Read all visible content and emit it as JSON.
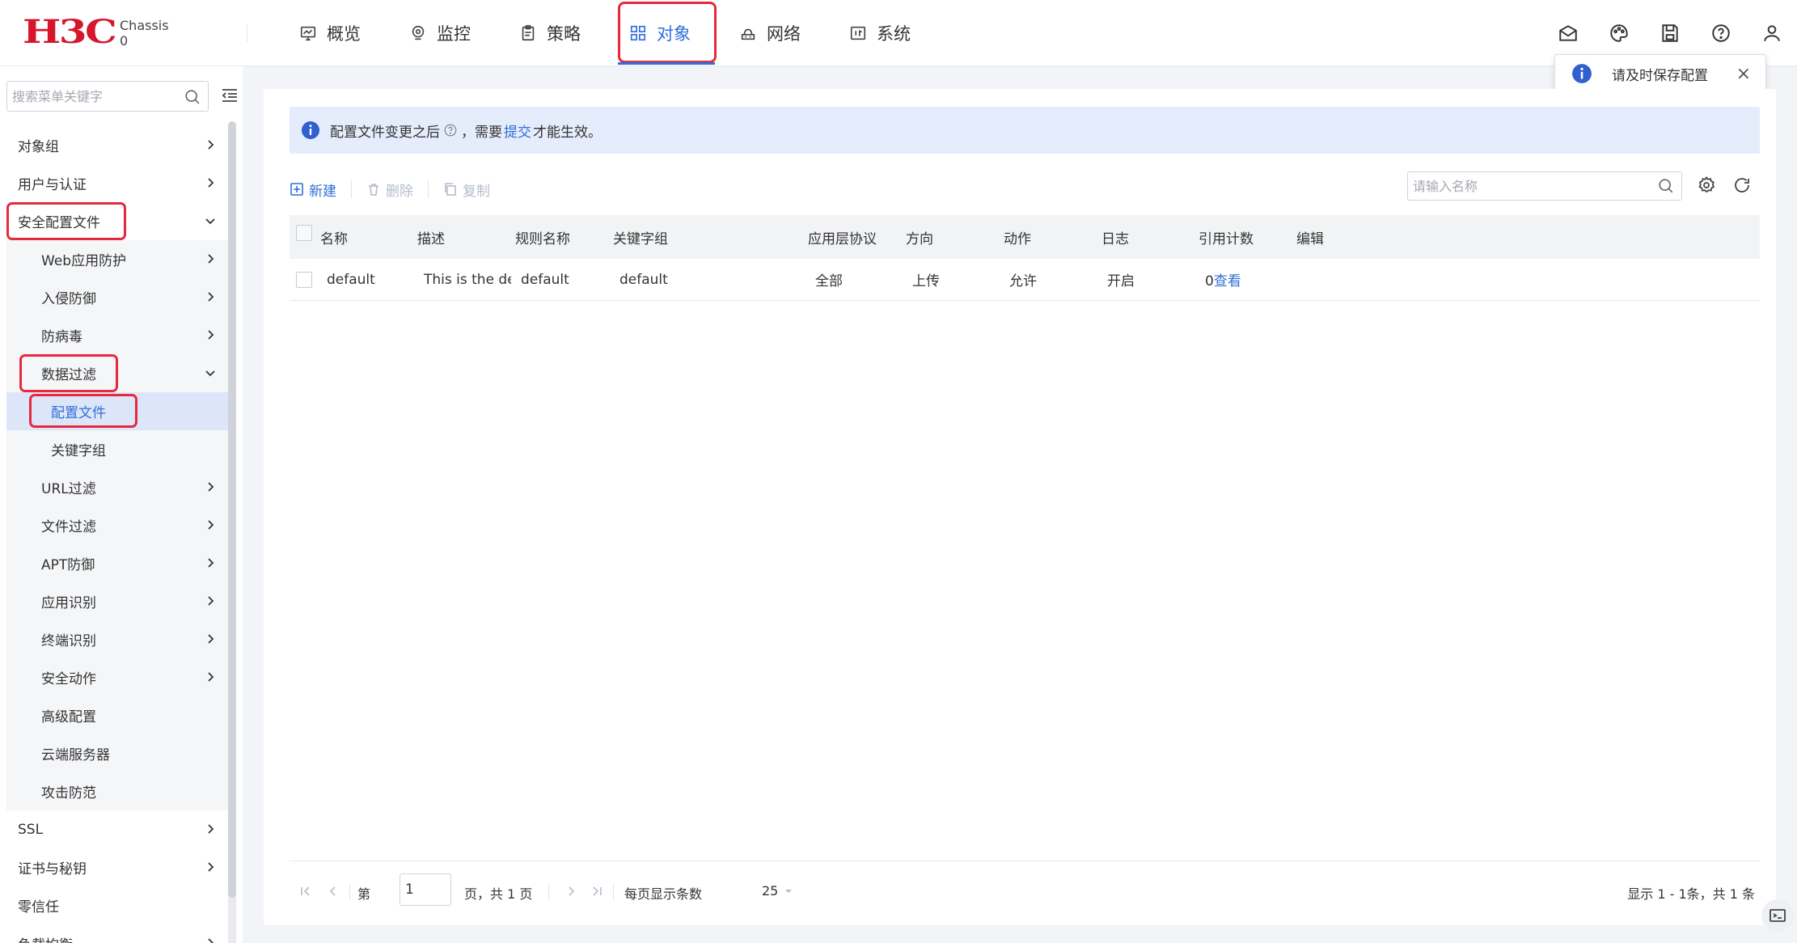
{
  "brand": {
    "logo_text": "H3C",
    "device_line1": "Chassis",
    "device_line2": "0"
  },
  "nav": {
    "items": [
      {
        "label": "概览",
        "icon": "monitor-chart-icon"
      },
      {
        "label": "监控",
        "icon": "location-pin-icon"
      },
      {
        "label": "策略",
        "icon": "clipboard-icon"
      },
      {
        "label": "对象",
        "icon": "grid-icon"
      },
      {
        "label": "网络",
        "icon": "network-icon"
      },
      {
        "label": "系统",
        "icon": "system-icon"
      }
    ],
    "active": "对象"
  },
  "top_icons": [
    "mail-icon",
    "palette-icon",
    "save-icon",
    "help-icon",
    "user-icon"
  ],
  "toast": {
    "text": "请及时保存配置",
    "close": "×"
  },
  "sidebar": {
    "search_placeholder": "搜索菜单关键字",
    "items": [
      {
        "label": "对象组"
      },
      {
        "label": "用户与认证"
      },
      {
        "label": "安全配置文件"
      },
      {
        "label": "Web应用防护"
      },
      {
        "label": "入侵防御"
      },
      {
        "label": "防病毒"
      },
      {
        "label": "数据过滤"
      },
      {
        "label": "配置文件"
      },
      {
        "label": "关键字组"
      },
      {
        "label": "URL过滤"
      },
      {
        "label": "文件过滤"
      },
      {
        "label": "APT防御"
      },
      {
        "label": "应用识别"
      },
      {
        "label": "终端识别"
      },
      {
        "label": "安全动作"
      },
      {
        "label": "高级配置"
      },
      {
        "label": "云端服务器"
      },
      {
        "label": "攻击防范"
      },
      {
        "label": "SSL"
      },
      {
        "label": "证书与秘钥"
      },
      {
        "label": "零信任"
      },
      {
        "label": "负载均衡"
      }
    ]
  },
  "banner": {
    "text_before": "配置文件变更之后",
    "text_middle": "，需要",
    "link": "提交",
    "text_after": "才能生效。"
  },
  "toolbar": {
    "new_label": "新建",
    "delete_label": "删除",
    "copy_label": "复制",
    "search_placeholder": "请输入名称"
  },
  "table": {
    "columns": [
      "名称",
      "描述",
      "规则名称",
      "关键字组",
      "应用层协议",
      "方向",
      "动作",
      "日志",
      "引用计数",
      "编辑"
    ],
    "rows": [
      {
        "name": "default",
        "desc": "This is the default",
        "rule": "default",
        "keyword_group": "default",
        "protocol": "全部",
        "direction": "上传",
        "action": "允许",
        "log": "开启",
        "ref_count": "0",
        "ref_link": "查看"
      }
    ]
  },
  "pager": {
    "page_prefix": "第",
    "page_value": "1",
    "page_suffix": "页，共 1 页",
    "per_page_label": "每页显示条数",
    "per_page_value": "25",
    "summary": "显示 1 - 1条，共 1 条"
  },
  "colors": {
    "accent": "#2f6fd8",
    "highlight": "#e6293e",
    "brand": "#d6162d"
  }
}
